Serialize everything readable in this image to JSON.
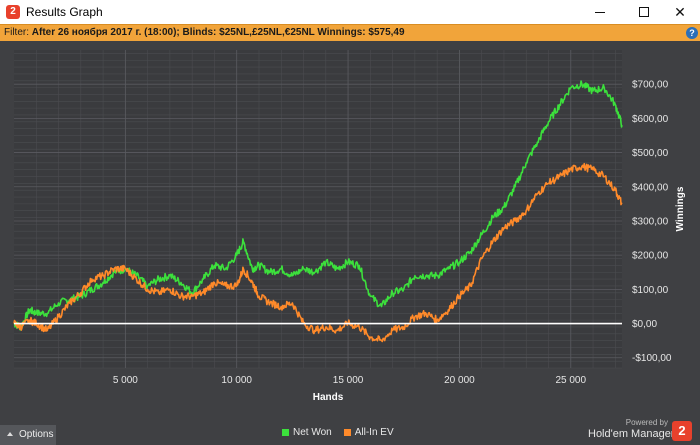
{
  "window": {
    "app_icon_text": "2",
    "title": "Results Graph",
    "minimize_icon": "minimize-icon",
    "maximize_icon": "maximize-icon",
    "close_icon": "close-icon",
    "close_glyph": "✕"
  },
  "filter": {
    "prefix": "Filter: ",
    "text": "After 26 ноября 2017 г. (18:00); Blinds: $25NL,£25NL,€25NL Winnings: $575,49",
    "help_glyph": "?"
  },
  "chart_data": {
    "type": "line",
    "xlabel": "Hands",
    "ylabel": "Winnings",
    "xlim": [
      0,
      27300
    ],
    "ylim": [
      -130,
      800
    ],
    "x_ticks": [
      5000,
      10000,
      15000,
      20000,
      25000
    ],
    "x_tick_labels": [
      "5 000",
      "10 000",
      "15 000",
      "20 000",
      "25 000"
    ],
    "y_ticks": [
      -100,
      0,
      100,
      200,
      300,
      400,
      500,
      600,
      700
    ],
    "y_tick_labels": [
      "-$100,00",
      "$0,00",
      "$100,00",
      "$200,00",
      "$300,00",
      "$400,00",
      "$500,00",
      "$600,00",
      "$700,00"
    ],
    "grid": true,
    "legend_position": "bottom-center",
    "series": [
      {
        "name": "Net Won",
        "color": "#3ce03c",
        "x": [
          0,
          300,
          700,
          1000,
          1500,
          2000,
          2500,
          3000,
          3500,
          4000,
          4500,
          5000,
          5500,
          6000,
          6500,
          7000,
          7500,
          8000,
          8500,
          9000,
          9500,
          10000,
          10300,
          10700,
          11000,
          11500,
          12000,
          12500,
          13000,
          13500,
          14000,
          14500,
          15000,
          15500,
          16000,
          16500,
          17000,
          17500,
          18000,
          18500,
          19000,
          19500,
          20000,
          20500,
          21000,
          21500,
          22000,
          22500,
          23000,
          23500,
          24000,
          24500,
          25000,
          25500,
          26000,
          26500,
          27000,
          27300
        ],
        "y": [
          0,
          -10,
          40,
          30,
          30,
          60,
          70,
          80,
          100,
          120,
          150,
          160,
          140,
          110,
          130,
          140,
          120,
          90,
          130,
          170,
          160,
          200,
          240,
          160,
          170,
          150,
          160,
          140,
          160,
          150,
          180,
          160,
          180,
          170,
          80,
          50,
          90,
          100,
          140,
          140,
          140,
          160,
          180,
          210,
          260,
          310,
          340,
          400,
          470,
          530,
          590,
          640,
          690,
          700,
          680,
          690,
          640,
          580
        ]
      },
      {
        "name": "All-In EV",
        "color": "#ff8a2a",
        "x": [
          0,
          300,
          700,
          1000,
          1500,
          2000,
          2500,
          3000,
          3500,
          4000,
          4500,
          5000,
          5500,
          6000,
          6500,
          7000,
          7500,
          8000,
          8500,
          9000,
          9500,
          10000,
          10300,
          10700,
          11000,
          11500,
          12000,
          12500,
          13000,
          13500,
          14000,
          14500,
          15000,
          15500,
          16000,
          16500,
          17000,
          17500,
          18000,
          18500,
          19000,
          19500,
          20000,
          20500,
          21000,
          21500,
          22000,
          22500,
          23000,
          23500,
          24000,
          24500,
          25000,
          25500,
          26000,
          26500,
          27000,
          27300
        ],
        "y": [
          0,
          -10,
          10,
          0,
          -20,
          20,
          60,
          90,
          130,
          140,
          160,
          160,
          130,
          100,
          90,
          100,
          80,
          80,
          90,
          120,
          110,
          110,
          160,
          120,
          80,
          60,
          50,
          60,
          0,
          -20,
          -10,
          -20,
          0,
          -10,
          -40,
          -50,
          -20,
          -10,
          20,
          30,
          10,
          40,
          80,
          110,
          190,
          240,
          280,
          300,
          330,
          380,
          410,
          430,
          450,
          460,
          450,
          430,
          390,
          350
        ]
      }
    ]
  },
  "options_label": "Options",
  "powered_by": "Powered by",
  "brand_name": "Hold'em Manager",
  "brand_badge": "2"
}
